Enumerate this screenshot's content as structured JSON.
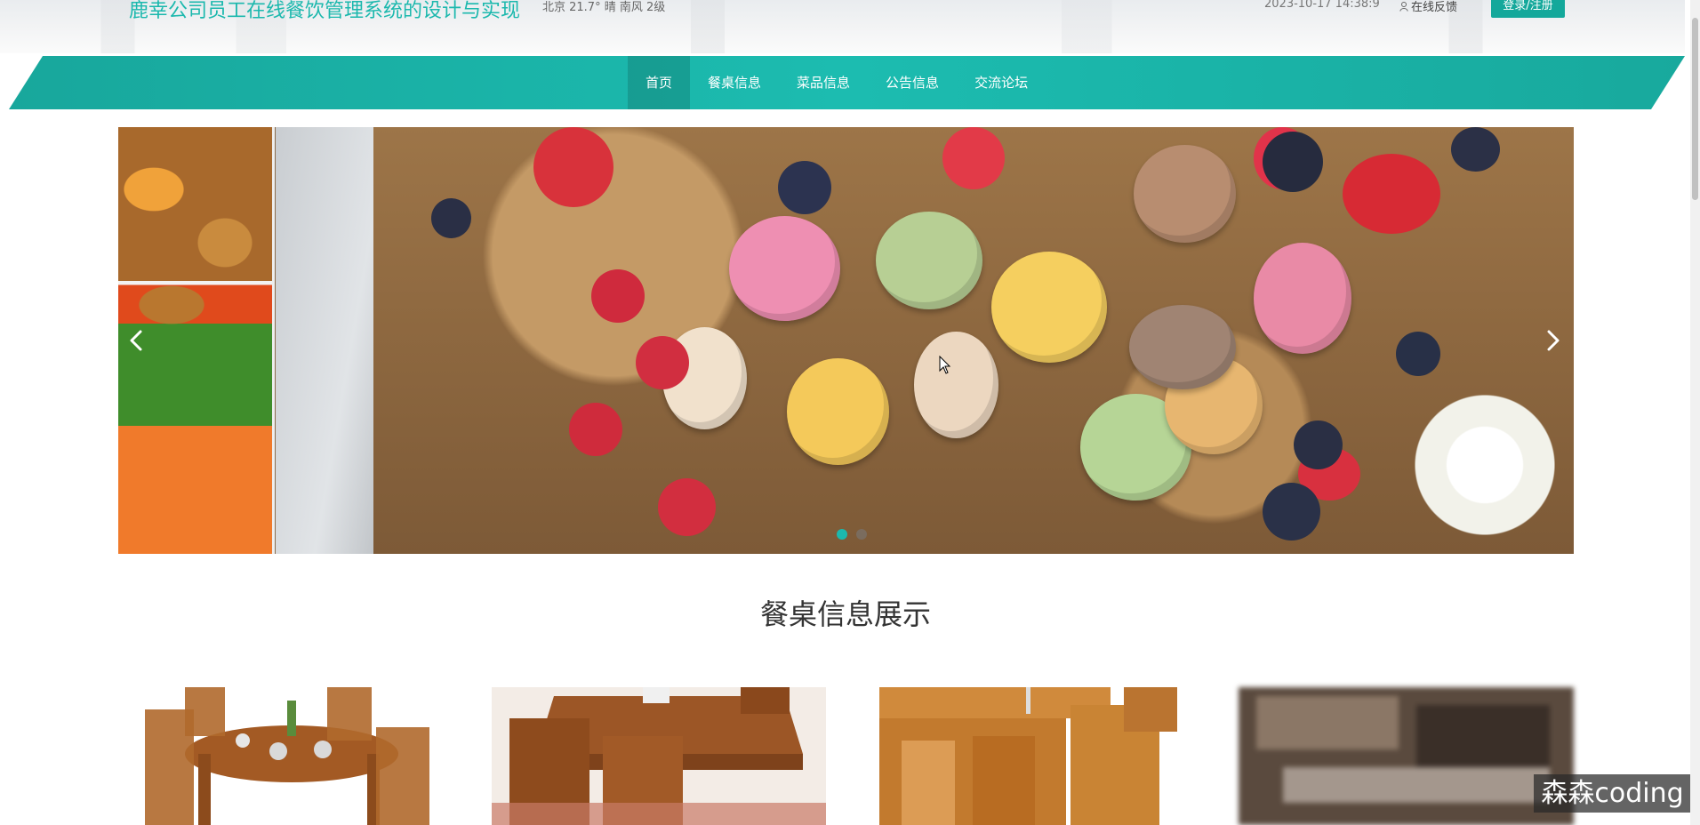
{
  "header": {
    "site_title": "鹿幸公司员工在线餐饮管理系统的设计与实现",
    "weather": "北京  21.7°  晴  南风  2级",
    "datetime": "2023-10-17 14:38:9",
    "feedback_label": "在线反馈",
    "login_label": "登录/注册"
  },
  "nav": {
    "items": [
      {
        "label": "首页",
        "active": true
      },
      {
        "label": "餐桌信息",
        "active": false
      },
      {
        "label": "菜品信息",
        "active": false
      },
      {
        "label": "公告信息",
        "active": false
      },
      {
        "label": "交流论坛",
        "active": false
      }
    ]
  },
  "carousel": {
    "prev_icon": "chevron-left-icon",
    "next_icon": "chevron-right-icon",
    "slide_count": 2,
    "active_index": 0
  },
  "section": {
    "title": "餐桌信息展示"
  },
  "watermark": "森森coding",
  "colors": {
    "accent": "#1bb8ad",
    "nav_band": "#19b5a9",
    "login_button": "#14a89b"
  }
}
